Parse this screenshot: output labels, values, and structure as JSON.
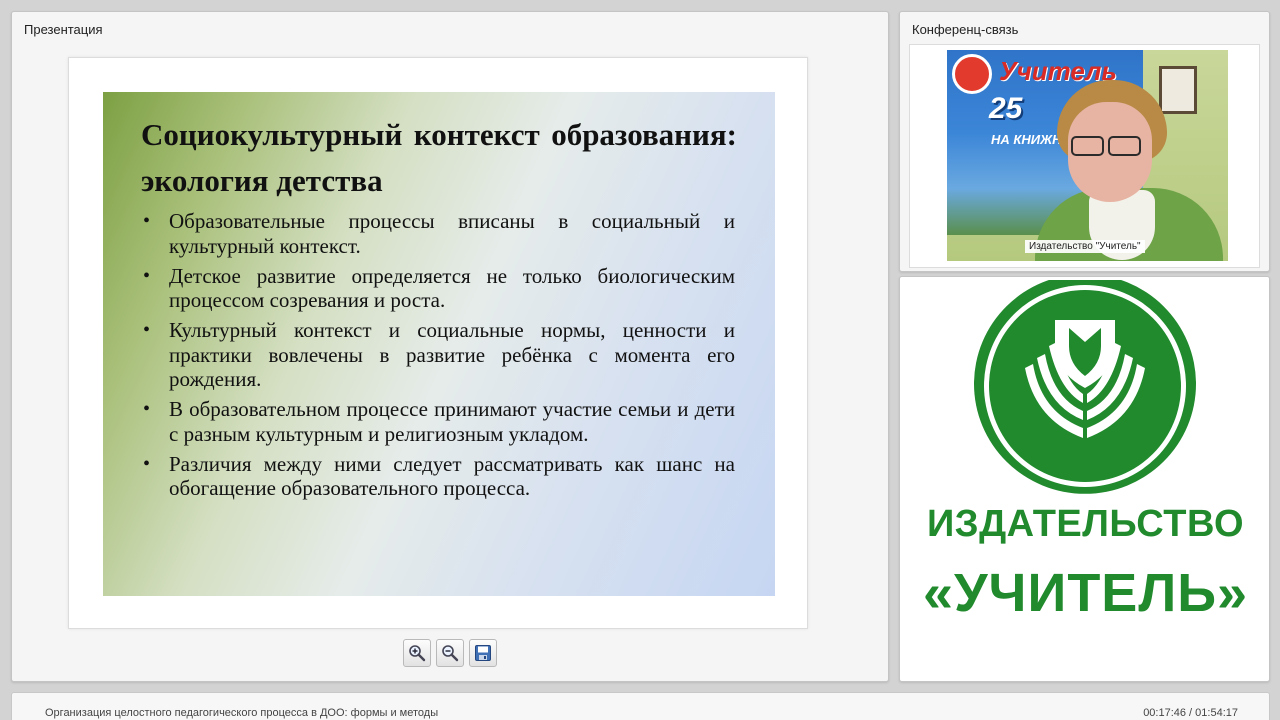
{
  "presentation": {
    "panel_title": "Презентация",
    "slide": {
      "title": "Социокультурный контекст образования: экология детства",
      "bullets": [
        "Образовательные процессы вписаны в социальный и культурный контекст.",
        "Детское развитие определяется не только биологическим процессом созревания и роста.",
        "Культурный контекст и социальные нормы, ценности и практики вовлечены в развитие ребёнка с момента его рождения.",
        "В образовательном процессе принимают участие семьи и дети с разным культурным и религиозным укладом.",
        "Различия между ними следует рассматривать как шанс на обогащение образовательного процесса."
      ],
      "colors": {
        "gradient_start": "#7da043",
        "gradient_end": "#c6d6f2"
      }
    },
    "toolbar": {
      "zoom_in_icon": "zoom-in-icon",
      "zoom_out_icon": "zoom-out-icon",
      "save_icon": "save-icon"
    }
  },
  "conference": {
    "panel_title": "Конференц-связь",
    "video_label": "Издательство \"Учитель\"",
    "poster": {
      "brand": "Учитель",
      "number": "25",
      "subtitle": "НА КНИЖНОМ"
    }
  },
  "logo": {
    "line1": "ИЗДАТЕЛЬСТВО",
    "line2": "«УЧИТЕЛЬ»",
    "color": "#208a2d"
  },
  "footer": {
    "title": "Организация целостного педагогического процесса в ДОО: формы и методы",
    "time": "00:17:46 / 01:54:17"
  }
}
